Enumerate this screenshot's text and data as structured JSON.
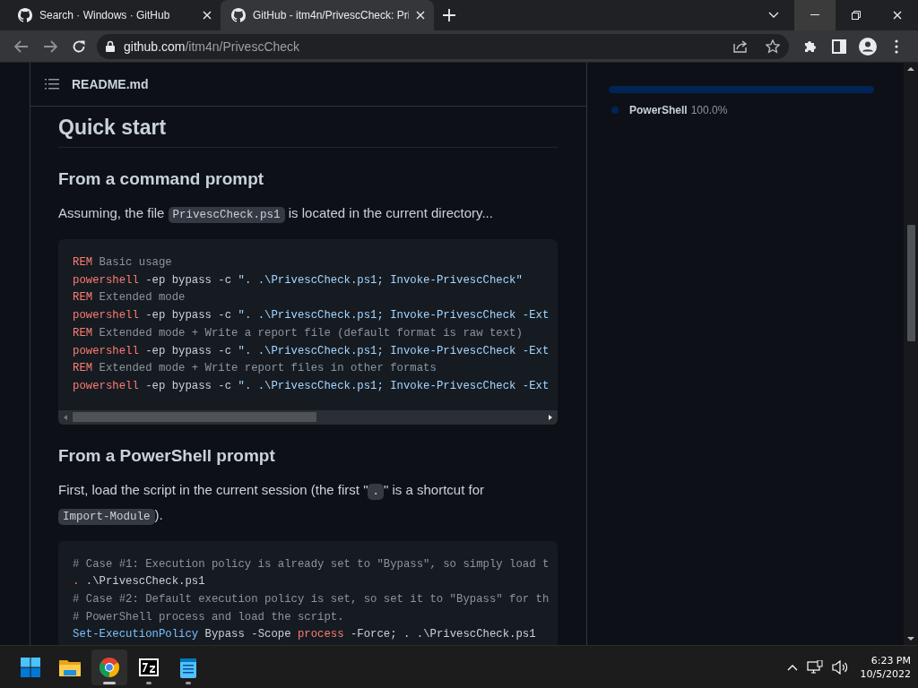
{
  "browser": {
    "tabs": [
      {
        "title": "Search · Windows · GitHub",
        "selected": false
      },
      {
        "title": "GitHub - itm4n/PrivescCheck: Pri",
        "selected": true
      }
    ],
    "address": {
      "host": "github.com",
      "path": "/itm4n/PrivescCheck"
    }
  },
  "readme": {
    "file_name": "README.md",
    "blocks": [
      {
        "kind": "h2",
        "text": "Quick start"
      },
      {
        "kind": "h3",
        "text": "From a command prompt"
      },
      {
        "kind": "p",
        "segments": [
          {
            "kind": "text",
            "text": "Assuming, the file "
          },
          {
            "kind": "code",
            "text": "PrivescCheck.ps1"
          },
          {
            "kind": "text",
            "text": " is located in the current directory..."
          }
        ]
      },
      {
        "kind": "code",
        "scrollbar": true,
        "lines": [
          [
            {
              "kind": "keyword",
              "text": "REM"
            },
            {
              "kind": "comment",
              "text": " Basic usage"
            }
          ],
          [
            {
              "kind": "keyword",
              "text": "powershell"
            },
            {
              "kind": "plain",
              "text": " -ep bypass -c "
            },
            {
              "kind": "string",
              "text": "\". .\\PrivescCheck.ps1; Invoke-PrivescCheck\""
            }
          ],
          [
            {
              "kind": "keyword",
              "text": "REM"
            },
            {
              "kind": "comment",
              "text": " Extended mode"
            }
          ],
          [
            {
              "kind": "keyword",
              "text": "powershell"
            },
            {
              "kind": "plain",
              "text": " -ep bypass -c "
            },
            {
              "kind": "string",
              "text": "\". .\\PrivescCheck.ps1; Invoke-PrivescCheck -Ext"
            }
          ],
          [
            {
              "kind": "keyword",
              "text": "REM"
            },
            {
              "kind": "comment",
              "text": " Extended mode + Write a report file (default format is raw text)"
            }
          ],
          [
            {
              "kind": "keyword",
              "text": "powershell"
            },
            {
              "kind": "plain",
              "text": " -ep bypass -c "
            },
            {
              "kind": "string",
              "text": "\". .\\PrivescCheck.ps1; Invoke-PrivescCheck -Ext"
            }
          ],
          [
            {
              "kind": "keyword",
              "text": "REM"
            },
            {
              "kind": "comment",
              "text": " Extended mode + Write report files in other formats"
            }
          ],
          [
            {
              "kind": "keyword",
              "text": "powershell"
            },
            {
              "kind": "plain",
              "text": " -ep bypass -c "
            },
            {
              "kind": "string",
              "text": "\". .\\PrivescCheck.ps1; Invoke-PrivescCheck -Ext"
            }
          ]
        ]
      },
      {
        "kind": "h3",
        "text": "From a PowerShell prompt"
      },
      {
        "kind": "p",
        "segments": [
          {
            "kind": "text",
            "text": "First, load the script in the current session (the first \""
          },
          {
            "kind": "code",
            "text": "."
          },
          {
            "kind": "text",
            "text": "\" is a shortcut for "
          },
          {
            "kind": "code",
            "text": "Import-Module"
          },
          {
            "kind": "text",
            "text": ")."
          }
        ]
      },
      {
        "kind": "code",
        "scrollbar": false,
        "lines": [
          [
            {
              "kind": "comment",
              "text": "# Case #1: Execution policy is already set to \"Bypass\", so simply load t"
            }
          ],
          [
            {
              "kind": "keyword",
              "text": "."
            },
            {
              "kind": "plain",
              "text": " .\\PrivescCheck.ps1"
            }
          ],
          [
            {
              "kind": "comment",
              "text": "# Case #2: Default execution policy is set, so set it to \"Bypass\" for th"
            }
          ],
          [
            {
              "kind": "comment",
              "text": "# PowerShell process and load the script."
            }
          ],
          [
            {
              "kind": "builtin",
              "text": "Set-ExecutionPolicy"
            },
            {
              "kind": "plain",
              "text": " Bypass -Scope "
            },
            {
              "kind": "keyword",
              "text": "process"
            },
            {
              "kind": "plain",
              "text": " -Force; . .\\PrivescCheck.ps1"
            }
          ]
        ]
      }
    ]
  },
  "languages": {
    "level": 1,
    "items": [
      {
        "name": "PowerShell",
        "percent": "100.0%",
        "color": "#012456"
      }
    ]
  },
  "taskbar": {
    "apps": [
      {
        "kind": "start",
        "running": false,
        "active": false
      },
      {
        "kind": "folder",
        "running": false,
        "active": false
      },
      {
        "kind": "chrome",
        "running": true,
        "active": true
      },
      {
        "kind": "archive",
        "running": true,
        "active": false
      },
      {
        "kind": "notepad",
        "running": true,
        "active": false
      }
    ],
    "time": "6:23 PM",
    "date": "10/5/2022"
  }
}
